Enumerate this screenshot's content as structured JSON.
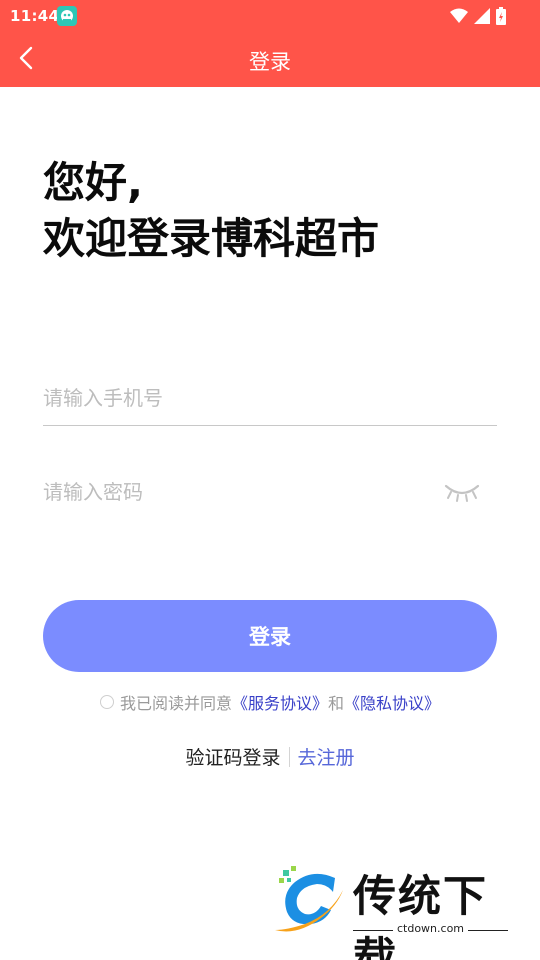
{
  "status_bar": {
    "time": "11:44",
    "icons": [
      "app-notification-icon",
      "wifi-icon",
      "signal-icon",
      "battery-charging-icon"
    ]
  },
  "header": {
    "title": "登录",
    "back_icon": "chevron-left-icon",
    "background_color": "#ff5449"
  },
  "greeting": {
    "line1": "您好,",
    "line2": "欢迎登录博科超市"
  },
  "form": {
    "phone_placeholder": "请输入手机号",
    "phone_value": "",
    "password_placeholder": "请输入密码",
    "password_value": "",
    "password_toggle_icon": "eye-closed-icon"
  },
  "login_button": {
    "label": "登录",
    "color": "#7b8cff"
  },
  "agreement": {
    "prefix": "我已阅读并同意",
    "service_link": "《服务协议》",
    "joiner": "和",
    "privacy_link": "《隐私协议》",
    "checked": false
  },
  "alt_links": {
    "sms_login": "验证码登录",
    "register": "去注册"
  },
  "watermark": {
    "brand": "传统下载",
    "domain": "ctdown.com"
  }
}
